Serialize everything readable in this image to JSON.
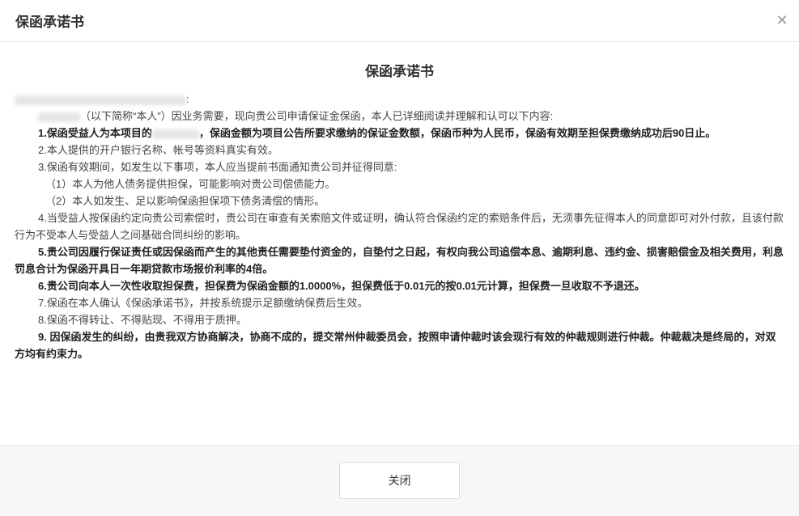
{
  "dialog": {
    "title": "保函承诺书",
    "close_icon": "close-icon"
  },
  "document": {
    "title": "保函承诺书",
    "addressee_suffix": ":",
    "intro": "（以下简称“本人”）因业务需要，现向贵公司申请保证金保函，本人已详细阅读并理解和认可以下内容:",
    "item1_prefix": "1.保函受益人为本项目的",
    "item1_suffix": "，保函金额为项目公告所要求缴纳的保证金数额，保函币种为人民币，保函有效期至担保费缴纳成功后90日止。",
    "item2": "2.本人提供的开户银行名称、帐号等资料真实有效。",
    "item3": "3.保函有效期间，如发生以下事项，本人应当提前书面通知贵公司并征得同意:",
    "item3_1": "（1）本人为他人债务提供担保，可能影响对贵公司偿债能力。",
    "item3_2": "（2）本人如发生、足以影响保函担保项下债务清偿的情形。",
    "item4": "4.当受益人按保函约定向贵公司索偿时，贵公司在审查有关索赔文件或证明，确认符合保函约定的索赔条件后，无须事先征得本人的同意即可对外付款，且该付款行为不受本人与受益人之间基础合同纠纷的影响。",
    "item5": "5.贵公司因履行保证责任或因保函而产生的其他责任需要垫付资金的，自垫付之日起，有权向我公司追偿本息、逾期利息、违约金、损害赔偿金及相关费用，利息罚息合计为保函开具日一年期贷款市场报价利率的4倍。",
    "item6": "6.贵公司向本人一次性收取担保费，担保费为保函金额的1.0000%，担保费低于0.01元的按0.01元计算，担保费一旦收取不予退还。",
    "item7": "7.保函在本人确认《保函承诺书》，并按系统提示足额缴纳保费后生效。",
    "item8": "8.保函不得转让、不得贴现、不得用于质押。",
    "item9": "9. 因保函发生的纠纷，由贵我双方协商解决，协商不成的，提交常州仲裁委员会，按照申请仲裁时该会现行有效的仲裁规则进行仲裁。仲裁裁决是终局的，对双方均有约束力。"
  },
  "footer": {
    "close_label": "关闭"
  }
}
